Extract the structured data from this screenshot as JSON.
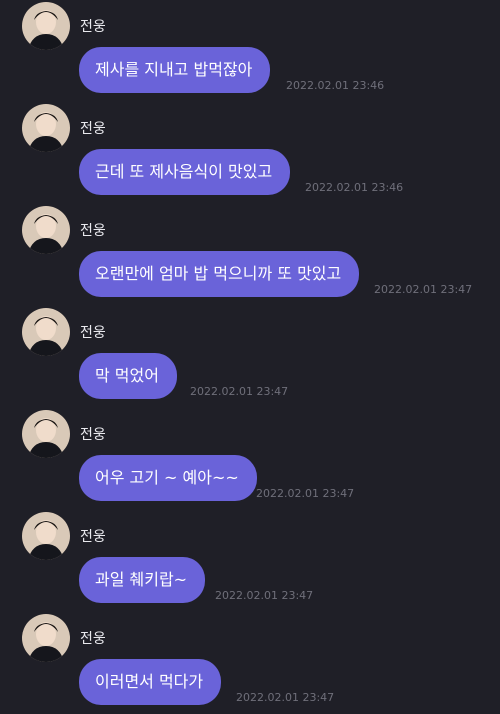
{
  "messages": [
    {
      "sender": "전웅",
      "text": "제사를 지내고 밥먹잖아",
      "time": "2022.02.01 23:46"
    },
    {
      "sender": "전웅",
      "text": "근데 또 제사음식이 맛있고",
      "time": "2022.02.01 23:46"
    },
    {
      "sender": "전웅",
      "text": "오랜만에 엄마 밥 먹으니까 또 맛있고",
      "time": "2022.02.01 23:47"
    },
    {
      "sender": "전웅",
      "text": "막 먹었어",
      "time": "2022.02.01 23:47"
    },
    {
      "sender": "전웅",
      "text": "어우 고기 ~ 예아~~",
      "time": "2022.02.01 23:47"
    },
    {
      "sender": "전웅",
      "text": "과일 췌키랍~",
      "time": "2022.02.01 23:47"
    },
    {
      "sender": "전웅",
      "text": "이러면서 먹다가",
      "time": "2022.02.01 23:47"
    }
  ],
  "colors": {
    "background": "#1f1f27",
    "bubble": "#6a63d9",
    "timestamp": "#6f6f7a",
    "name": "#e9e9ee"
  }
}
